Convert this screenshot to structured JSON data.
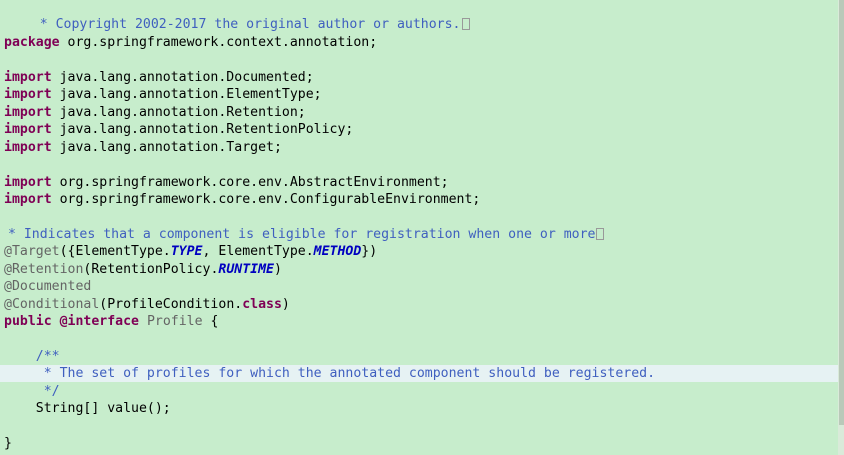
{
  "editor": {
    "line_copyright": " * Copyright 2002-2017 the original author or authors.",
    "kw_package": "package",
    "package_name": " org.springframework.context.annotation;",
    "kw_import": "import",
    "imports": [
      " java.lang.annotation.Documented;",
      " java.lang.annotation.ElementType;",
      " java.lang.annotation.Retention;",
      " java.lang.annotation.RetentionPolicy;",
      " java.lang.annotation.Target;",
      " org.springframework.core.env.AbstractEnvironment;",
      " org.springframework.core.env.ConfigurableEnvironment;"
    ],
    "javadoc_summary": " * Indicates that a component is eligible for registration when one or more",
    "ann_target": "@Target",
    "target_args_open": "({ElementType.",
    "enum_type": "TYPE",
    "target_args_mid": ", ElementType.",
    "enum_method": "METHOD",
    "target_args_close": "})",
    "ann_retention": "@Retention",
    "retention_args_open": "(RetentionPolicy.",
    "enum_runtime": "RUNTIME",
    "retention_args_close": ")",
    "ann_documented": "@Documented",
    "ann_conditional": "@Conditional",
    "conditional_args_open": "(ProfileCondition.",
    "kw_class": "class",
    "conditional_args_close": ")",
    "kw_public": "public",
    "kw_interface": "@interface",
    "type_name": "Profile",
    "open_brace": " {",
    "doc_open": "    /**",
    "doc_body": "     * The set of profiles for which the annotated component should be registered.",
    "doc_close": "     */",
    "method_decl": "    String[] value();",
    "close_brace": "}"
  },
  "colors": {
    "background": "#c7edcc",
    "keyword": "#7f0055",
    "comment": "#3f5fbf",
    "annotation": "#646464",
    "enum_constant": "#0000c0",
    "current_line": "#e6f2f3"
  }
}
